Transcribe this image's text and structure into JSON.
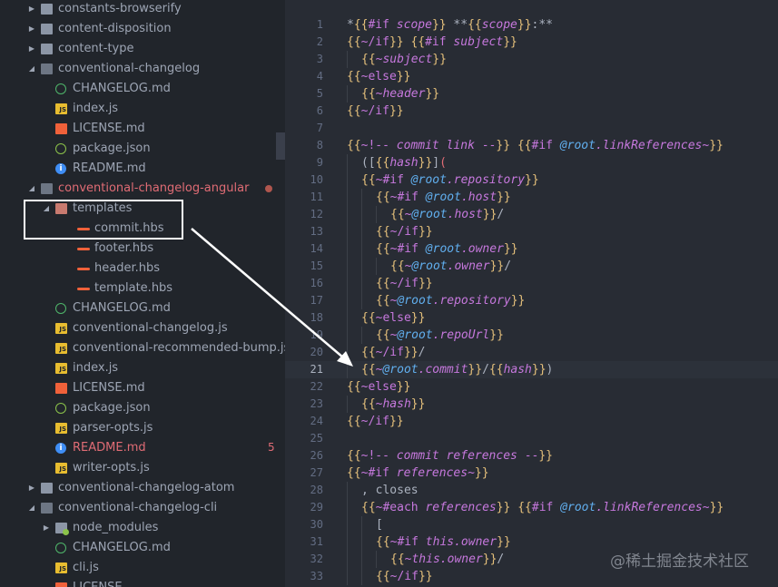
{
  "sidebar": {
    "items": [
      {
        "label": "constants-browserify",
        "type": "folder",
        "expanded": false,
        "depth": 1,
        "icon": "folder-icon"
      },
      {
        "label": "content-disposition",
        "type": "folder",
        "expanded": false,
        "depth": 1,
        "icon": "folder-icon"
      },
      {
        "label": "content-type",
        "type": "folder",
        "expanded": false,
        "depth": 1,
        "icon": "folder-icon"
      },
      {
        "label": "conventional-changelog",
        "type": "folder",
        "expanded": true,
        "depth": 1,
        "icon": "folder-open-icon"
      },
      {
        "label": "CHANGELOG.md",
        "type": "file",
        "depth": 2,
        "icon": "changelog-icon"
      },
      {
        "label": "index.js",
        "type": "file",
        "depth": 2,
        "icon": "js-icon"
      },
      {
        "label": "LICENSE.md",
        "type": "file",
        "depth": 2,
        "icon": "license-icon"
      },
      {
        "label": "package.json",
        "type": "file",
        "depth": 2,
        "icon": "npm-package-icon"
      },
      {
        "label": "README.md",
        "type": "file",
        "depth": 2,
        "icon": "readme-info-icon"
      },
      {
        "label": "conventional-changelog-angular",
        "type": "folder",
        "expanded": true,
        "depth": 1,
        "icon": "folder-open-icon",
        "color": "#e06c75",
        "modified": true
      },
      {
        "label": "templates",
        "type": "folder",
        "expanded": true,
        "depth": 2,
        "icon": "templates-folder-icon"
      },
      {
        "label": "commit.hbs",
        "type": "file",
        "depth": 3,
        "icon": "handlebars-icon",
        "selected": true
      },
      {
        "label": "footer.hbs",
        "type": "file",
        "depth": 3,
        "icon": "handlebars-icon"
      },
      {
        "label": "header.hbs",
        "type": "file",
        "depth": 3,
        "icon": "handlebars-icon"
      },
      {
        "label": "template.hbs",
        "type": "file",
        "depth": 3,
        "icon": "handlebars-icon"
      },
      {
        "label": "CHANGELOG.md",
        "type": "file",
        "depth": 2,
        "icon": "changelog-icon"
      },
      {
        "label": "conventional-changelog.js",
        "type": "file",
        "depth": 2,
        "icon": "js-icon"
      },
      {
        "label": "conventional-recommended-bump.js",
        "type": "file",
        "depth": 2,
        "icon": "js-icon"
      },
      {
        "label": "index.js",
        "type": "file",
        "depth": 2,
        "icon": "js-icon"
      },
      {
        "label": "LICENSE.md",
        "type": "file",
        "depth": 2,
        "icon": "license-icon"
      },
      {
        "label": "package.json",
        "type": "file",
        "depth": 2,
        "icon": "npm-package-icon"
      },
      {
        "label": "parser-opts.js",
        "type": "file",
        "depth": 2,
        "icon": "js-icon"
      },
      {
        "label": "README.md",
        "type": "file",
        "depth": 2,
        "icon": "readme-info-icon",
        "color": "#e06c75",
        "badge": "5"
      },
      {
        "label": "writer-opts.js",
        "type": "file",
        "depth": 2,
        "icon": "js-icon"
      },
      {
        "label": "conventional-changelog-atom",
        "type": "folder",
        "expanded": false,
        "depth": 1,
        "icon": "folder-icon"
      },
      {
        "label": "conventional-changelog-cli",
        "type": "folder",
        "expanded": true,
        "depth": 1,
        "icon": "folder-open-icon"
      },
      {
        "label": "node_modules",
        "type": "folder",
        "expanded": false,
        "depth": 2,
        "icon": "node-modules-folder-icon"
      },
      {
        "label": "CHANGELOG.md",
        "type": "file",
        "depth": 2,
        "icon": "changelog-icon"
      },
      {
        "label": "cli.js",
        "type": "file",
        "depth": 2,
        "icon": "js-icon"
      },
      {
        "label": "LICENSE",
        "type": "file",
        "depth": 2,
        "icon": "license-icon"
      }
    ]
  },
  "editor": {
    "active_line": 21,
    "lines": [
      {
        "n": "1",
        "indent": 0,
        "t": [
          [
            "p",
            "*"
          ],
          [
            "b",
            "{{"
          ],
          [
            "k",
            "#if "
          ],
          [
            "v",
            "scope"
          ],
          [
            "b",
            "}}"
          ],
          [
            "p",
            " **"
          ],
          [
            "b",
            "{{"
          ],
          [
            "v",
            "scope"
          ],
          [
            "b",
            "}}"
          ],
          [
            "p",
            ":**"
          ]
        ]
      },
      {
        "n": "2",
        "indent": 0,
        "t": [
          [
            "b",
            "{{"
          ],
          [
            "k",
            "~/if"
          ],
          [
            "b",
            "}}"
          ],
          [
            "p",
            " "
          ],
          [
            "b",
            "{{"
          ],
          [
            "k",
            "#if "
          ],
          [
            "v",
            "subject"
          ],
          [
            "b",
            "}}"
          ]
        ]
      },
      {
        "n": "3",
        "indent": 1,
        "t": [
          [
            "b",
            "{{"
          ],
          [
            "v",
            "~subject"
          ],
          [
            "b",
            "}}"
          ]
        ]
      },
      {
        "n": "4",
        "indent": 0,
        "t": [
          [
            "b",
            "{{"
          ],
          [
            "k",
            "~else"
          ],
          [
            "b",
            "}}"
          ]
        ]
      },
      {
        "n": "5",
        "indent": 1,
        "t": [
          [
            "b",
            "{{"
          ],
          [
            "v",
            "~header"
          ],
          [
            "b",
            "}}"
          ]
        ]
      },
      {
        "n": "6",
        "indent": 0,
        "t": [
          [
            "b",
            "{{"
          ],
          [
            "k",
            "~/if"
          ],
          [
            "b",
            "}}"
          ]
        ]
      },
      {
        "n": "7",
        "indent": 0,
        "t": []
      },
      {
        "n": "8",
        "indent": 0,
        "t": [
          [
            "b",
            "{{"
          ],
          [
            "k",
            "~!-- "
          ],
          [
            "v",
            "commit link "
          ],
          [
            "k",
            "--"
          ],
          [
            "b",
            "}}"
          ],
          [
            "p",
            " "
          ],
          [
            "b",
            "{{"
          ],
          [
            "k",
            "#if "
          ],
          [
            "a",
            "@root"
          ],
          [
            "v",
            ".linkReferences"
          ],
          [
            "k",
            "~"
          ],
          [
            "b",
            "}}"
          ]
        ]
      },
      {
        "n": "9",
        "indent": 1,
        "t": [
          [
            "p",
            "(["
          ],
          [
            "b",
            "{{"
          ],
          [
            "v",
            "hash"
          ],
          [
            "b",
            "}}"
          ],
          [
            "p",
            "]"
          ],
          [
            "h",
            "("
          ]
        ]
      },
      {
        "n": "10",
        "indent": 1,
        "t": [
          [
            "b",
            "{{"
          ],
          [
            "k",
            "~#if "
          ],
          [
            "a",
            "@root"
          ],
          [
            "v",
            ".repository"
          ],
          [
            "b",
            "}}"
          ]
        ]
      },
      {
        "n": "11",
        "indent": 2,
        "t": [
          [
            "b",
            "{{"
          ],
          [
            "k",
            "~#if "
          ],
          [
            "a",
            "@root"
          ],
          [
            "v",
            ".host"
          ],
          [
            "b",
            "}}"
          ]
        ]
      },
      {
        "n": "12",
        "indent": 3,
        "t": [
          [
            "b",
            "{{"
          ],
          [
            "k",
            "~"
          ],
          [
            "a",
            "@root"
          ],
          [
            "v",
            ".host"
          ],
          [
            "b",
            "}}"
          ],
          [
            "p",
            "/"
          ]
        ]
      },
      {
        "n": "13",
        "indent": 2,
        "t": [
          [
            "b",
            "{{"
          ],
          [
            "k",
            "~/if"
          ],
          [
            "b",
            "}}"
          ]
        ]
      },
      {
        "n": "14",
        "indent": 2,
        "t": [
          [
            "b",
            "{{"
          ],
          [
            "k",
            "~#if "
          ],
          [
            "a",
            "@root"
          ],
          [
            "v",
            ".owner"
          ],
          [
            "b",
            "}}"
          ]
        ]
      },
      {
        "n": "15",
        "indent": 3,
        "t": [
          [
            "b",
            "{{"
          ],
          [
            "k",
            "~"
          ],
          [
            "a",
            "@root"
          ],
          [
            "v",
            ".owner"
          ],
          [
            "b",
            "}}"
          ],
          [
            "p",
            "/"
          ]
        ]
      },
      {
        "n": "16",
        "indent": 2,
        "t": [
          [
            "b",
            "{{"
          ],
          [
            "k",
            "~/if"
          ],
          [
            "b",
            "}}"
          ]
        ]
      },
      {
        "n": "17",
        "indent": 2,
        "t": [
          [
            "b",
            "{{"
          ],
          [
            "k",
            "~"
          ],
          [
            "a",
            "@root"
          ],
          [
            "v",
            ".repository"
          ],
          [
            "b",
            "}}"
          ]
        ]
      },
      {
        "n": "18",
        "indent": 1,
        "t": [
          [
            "b",
            "{{"
          ],
          [
            "k",
            "~else"
          ],
          [
            "b",
            "}}"
          ]
        ]
      },
      {
        "n": "19",
        "indent": 2,
        "t": [
          [
            "b",
            "{{"
          ],
          [
            "k",
            "~"
          ],
          [
            "a",
            "@root"
          ],
          [
            "v",
            ".repoUrl"
          ],
          [
            "b",
            "}}"
          ]
        ]
      },
      {
        "n": "20",
        "indent": 1,
        "t": [
          [
            "b",
            "{{"
          ],
          [
            "k",
            "~/if"
          ],
          [
            "b",
            "}}"
          ],
          [
            "p",
            "/"
          ]
        ]
      },
      {
        "n": "21",
        "indent": 1,
        "t": [
          [
            "b",
            "{{"
          ],
          [
            "k",
            "~"
          ],
          [
            "a",
            "@root"
          ],
          [
            "v",
            ".commit"
          ],
          [
            "b",
            "}}"
          ],
          [
            "p",
            "/"
          ],
          [
            "b",
            "{{"
          ],
          [
            "v",
            "hash"
          ],
          [
            "b",
            "}}"
          ],
          [
            "p",
            ")"
          ]
        ]
      },
      {
        "n": "22",
        "indent": 0,
        "t": [
          [
            "b",
            "{{"
          ],
          [
            "k",
            "~else"
          ],
          [
            "b",
            "}}"
          ]
        ]
      },
      {
        "n": "23",
        "indent": 1,
        "t": [
          [
            "b",
            "{{"
          ],
          [
            "v",
            "~hash"
          ],
          [
            "b",
            "}}"
          ]
        ]
      },
      {
        "n": "24",
        "indent": 0,
        "t": [
          [
            "b",
            "{{"
          ],
          [
            "k",
            "~/if"
          ],
          [
            "b",
            "}}"
          ]
        ]
      },
      {
        "n": "25",
        "indent": 0,
        "t": []
      },
      {
        "n": "26",
        "indent": 0,
        "t": [
          [
            "b",
            "{{"
          ],
          [
            "k",
            "~!-- "
          ],
          [
            "v",
            "commit references "
          ],
          [
            "k",
            "--"
          ],
          [
            "b",
            "}}"
          ]
        ]
      },
      {
        "n": "27",
        "indent": 0,
        "t": [
          [
            "b",
            "{{"
          ],
          [
            "k",
            "~#if "
          ],
          [
            "v",
            "references"
          ],
          [
            "k",
            "~"
          ],
          [
            "b",
            "}}"
          ]
        ]
      },
      {
        "n": "28",
        "indent": 1,
        "t": [
          [
            "p",
            ", closes"
          ]
        ]
      },
      {
        "n": "29",
        "indent": 1,
        "t": [
          [
            "b",
            "{{"
          ],
          [
            "k",
            "~#each "
          ],
          [
            "v",
            "references"
          ],
          [
            "b",
            "}}"
          ],
          [
            "p",
            " "
          ],
          [
            "b",
            "{{"
          ],
          [
            "k",
            "#if "
          ],
          [
            "a",
            "@root"
          ],
          [
            "v",
            ".linkReferences"
          ],
          [
            "k",
            "~"
          ],
          [
            "b",
            "}}"
          ]
        ]
      },
      {
        "n": "30",
        "indent": 2,
        "t": [
          [
            "p",
            "["
          ]
        ]
      },
      {
        "n": "31",
        "indent": 2,
        "t": [
          [
            "b",
            "{{"
          ],
          [
            "k",
            "~#if "
          ],
          [
            "v",
            "this.owner"
          ],
          [
            "b",
            "}}"
          ]
        ]
      },
      {
        "n": "32",
        "indent": 3,
        "t": [
          [
            "b",
            "{{"
          ],
          [
            "v",
            "~this.owner"
          ],
          [
            "b",
            "}}"
          ],
          [
            "p",
            "/"
          ]
        ]
      },
      {
        "n": "33",
        "indent": 2,
        "t": [
          [
            "b",
            "{{"
          ],
          [
            "k",
            "~/if"
          ],
          [
            "b",
            "}}"
          ]
        ]
      }
    ]
  },
  "annotation": {
    "highlight_target": "templates/commit.hbs",
    "arrow_to_line": 21
  },
  "watermark": "@稀土掘金技术社区",
  "colors": {
    "sidebar_bg": "#21252b",
    "editor_bg": "#282c34",
    "modified": "#e06c75",
    "brace": "#e5c07b",
    "keyword": "#c678dd"
  }
}
